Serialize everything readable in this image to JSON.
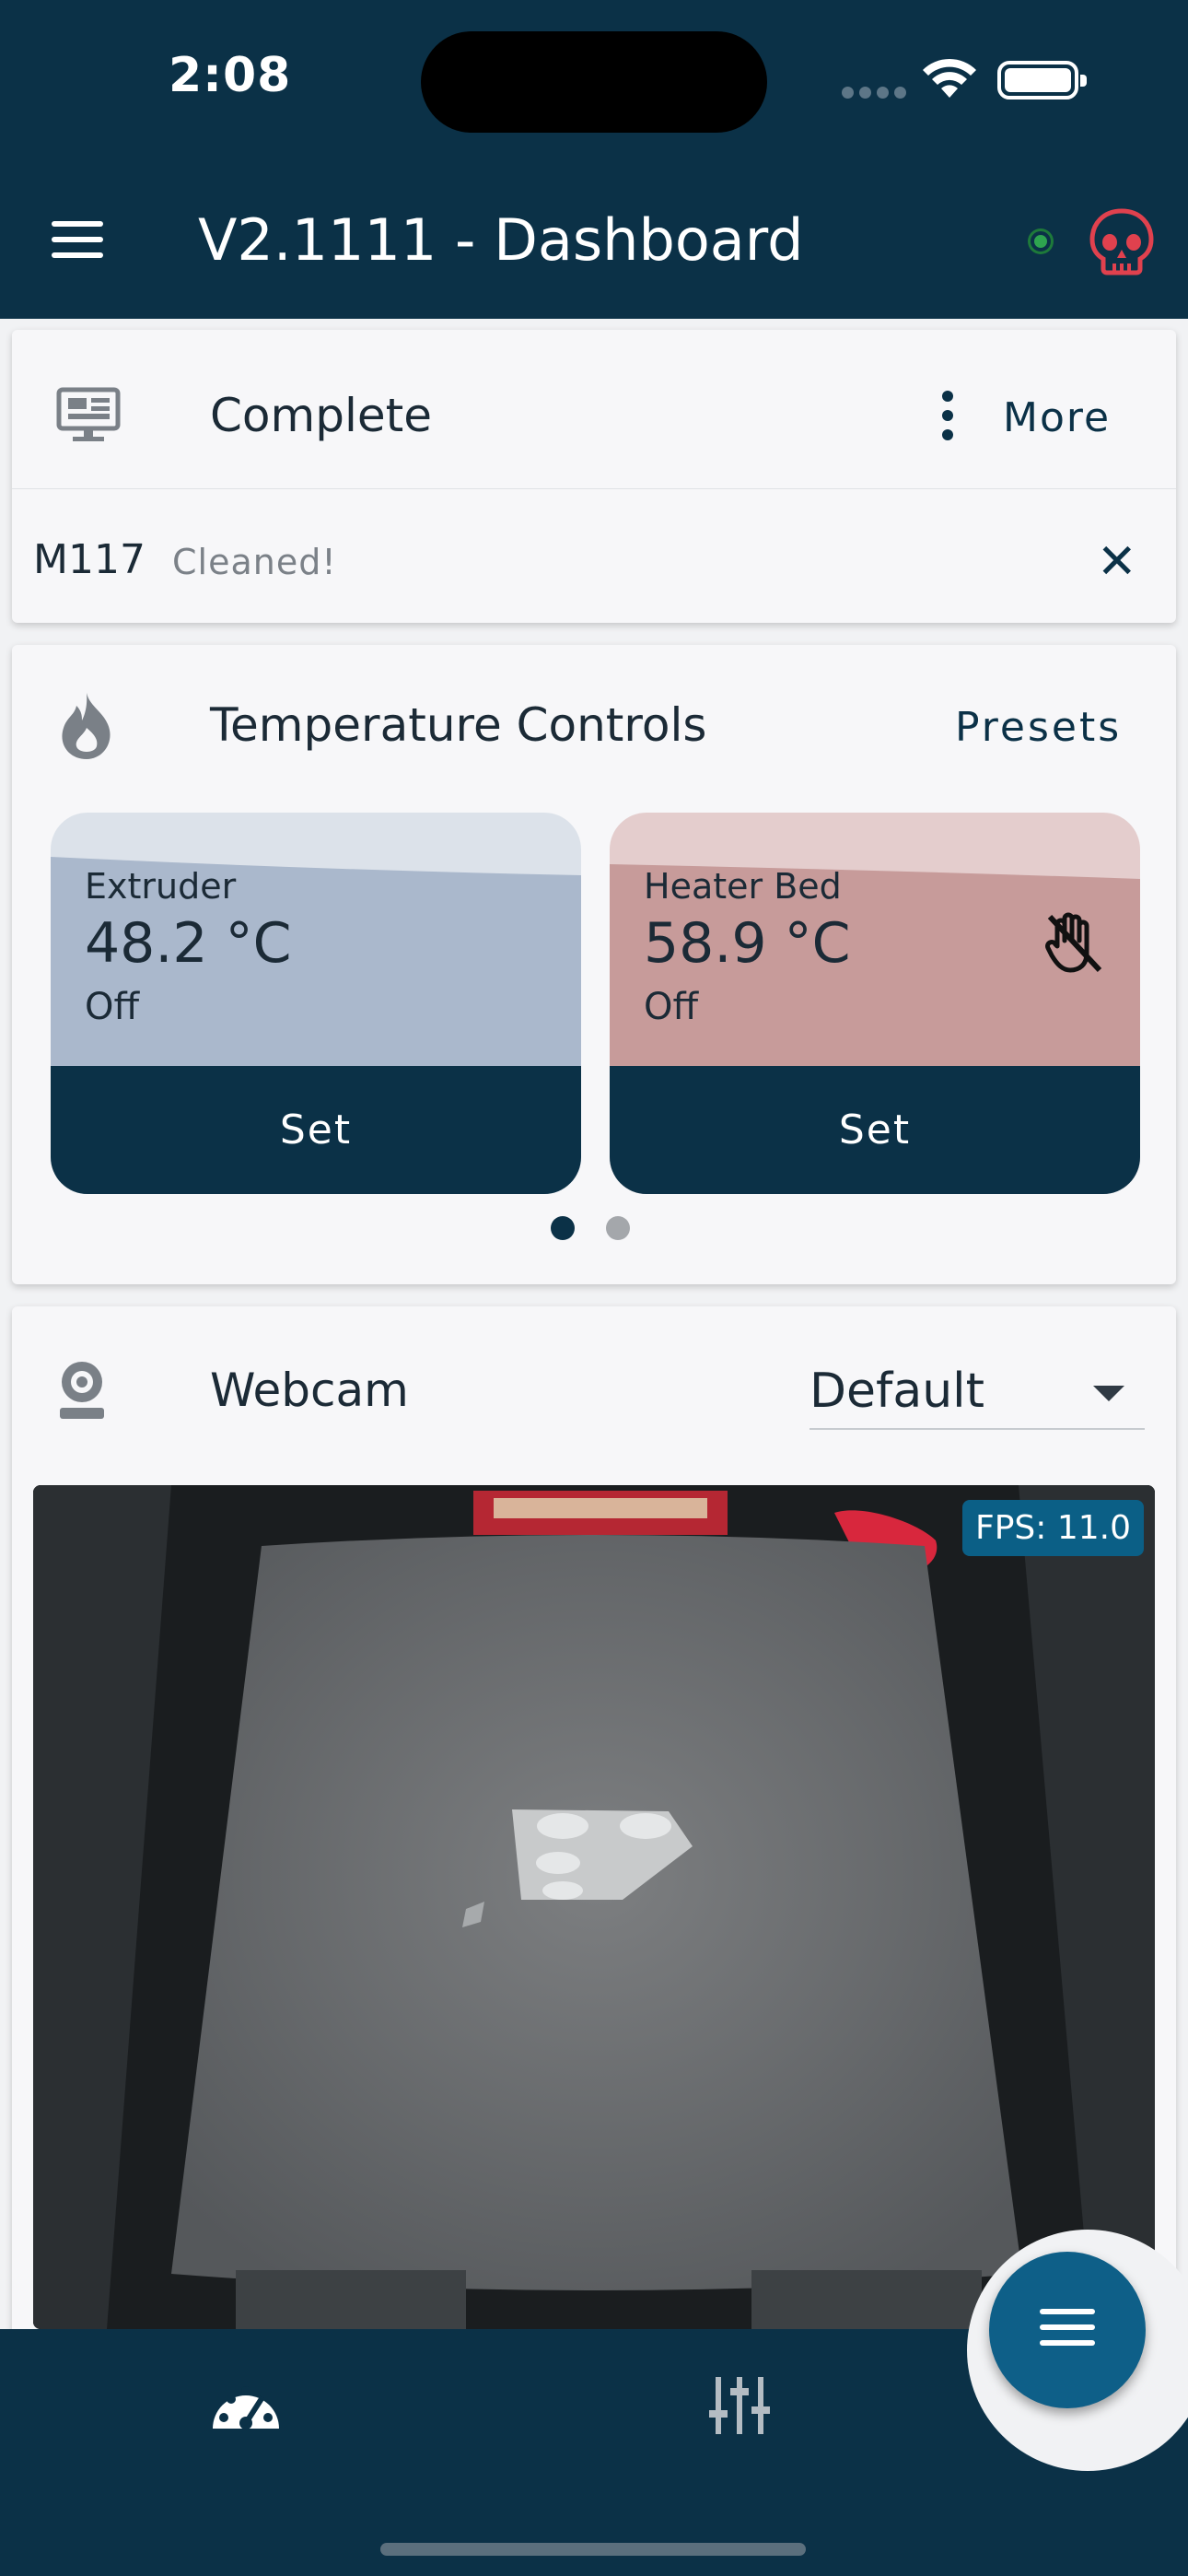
{
  "status_bar": {
    "time": "2:08"
  },
  "app_bar": {
    "title": "V2.1111 - Dashboard"
  },
  "status_card": {
    "title": "Complete",
    "more_label": "More",
    "gcode_command": "M117",
    "gcode_message": "Cleaned!"
  },
  "temperature_card": {
    "title": "Temperature Controls",
    "presets_label": "Presets",
    "heaters": [
      {
        "name": "Extruder",
        "value": "48.2 °C",
        "state": "Off",
        "set_label": "Set",
        "color": "#aab8cc"
      },
      {
        "name": "Heater Bed",
        "value": "58.9 °C",
        "state": "Off",
        "set_label": "Set",
        "color": "#c79b9a"
      }
    ],
    "page_indicator": {
      "pages": 2,
      "active": 1
    }
  },
  "webcam_card": {
    "title": "Webcam",
    "selected_camera": "Default",
    "fps_label": "FPS: 11.0"
  },
  "bottom_nav": {
    "items": [
      {
        "icon": "gauge-icon",
        "active": true
      },
      {
        "icon": "sliders-icon",
        "active": false
      }
    ]
  },
  "colors": {
    "primary": "#0b3147",
    "fab": "#0e5f88",
    "online": "#2ea44f",
    "alert": "#e0414e"
  }
}
